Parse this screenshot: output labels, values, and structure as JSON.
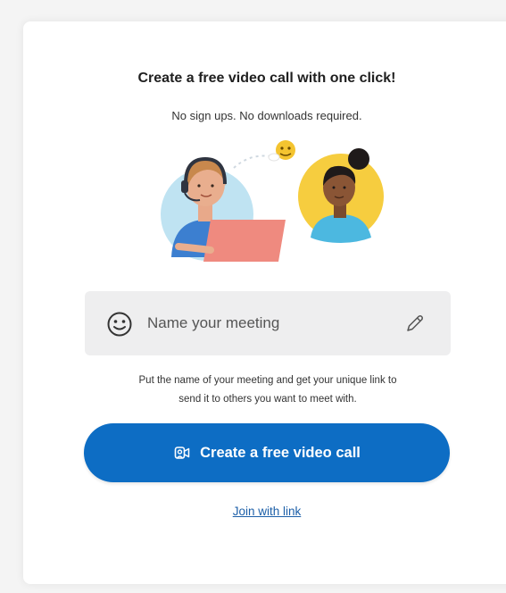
{
  "headline": "Create a free video call with one click!",
  "subhead": "No sign ups. No downloads required.",
  "meeting_name": {
    "placeholder": "Name your meeting",
    "value": "",
    "icon": "smiley-icon",
    "edit_icon": "pencil-icon"
  },
  "helper_text": {
    "line1": "Put the name of your meeting and get your unique link to",
    "line2": "send it to others you want to meet with."
  },
  "cta": {
    "label": "Create a free video call",
    "icon": "video-call-icon"
  },
  "join_link": "Join with link",
  "colors": {
    "accent": "#0d6dc4",
    "link": "#1c5fa8",
    "field_bg": "#eeeeef",
    "bubble_blue": "#bfe3f2",
    "bubble_yellow": "#f6cd3f"
  }
}
